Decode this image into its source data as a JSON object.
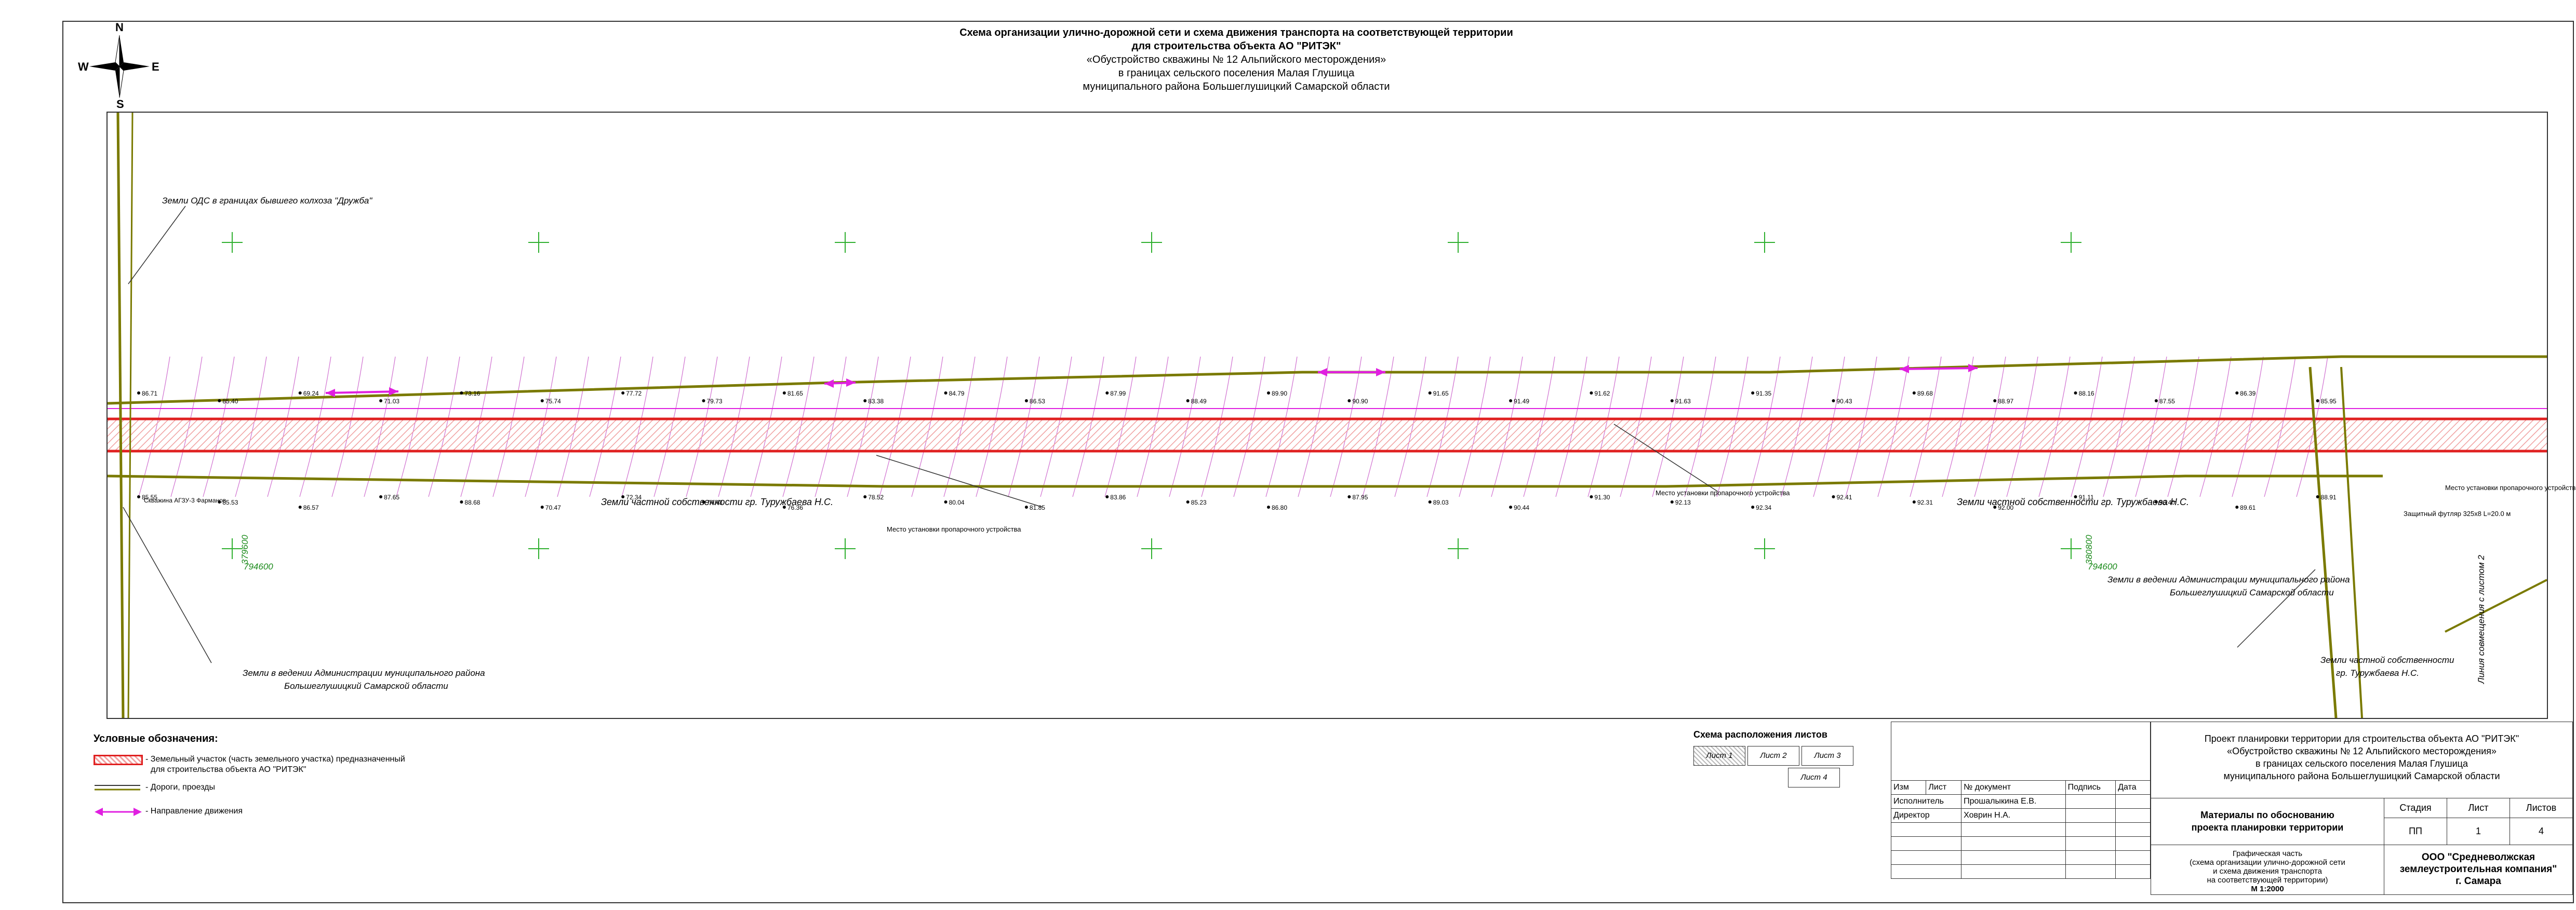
{
  "title": {
    "line1": "Схема организации улично-дорожной сети и схема движения транспорта на соответствующей территории",
    "line2": "для строительства объекта АО \"РИТЭК\"",
    "line3": "«Обустройство скважины № 12 Альпийского месторождения»",
    "line4": "в границах сельского поселения Малая Глушица",
    "line5": "муниципального района Большеглушицкий Самарской области"
  },
  "compass": {
    "n": "N",
    "s": "S",
    "w": "W",
    "e": "E"
  },
  "map_labels": {
    "ods_lands": "Земли ОДС в границах бывшего колхоза \"Дружба\"",
    "admin_lands_left_1": "Земли в ведении Администрации муниципального района",
    "admin_lands_left_2": "Большеглушицкий Самарской области",
    "private_lands_1": "Земли частной собственности гр. Туружбаева Н.С.",
    "private_lands_2": "Земли частной собственности гр. Туружбаева Н.С.",
    "admin_lands_right_1": "Земли в ведении Администрации муниципального района",
    "admin_lands_right_2": "Большеглушицкий Самарской области",
    "private_lands_right_1": "Земли частной собственности",
    "private_lands_right_2": "гр. Туружбаева Н.С.",
    "combine_line": "Линия совмещения с листом 2",
    "device_place_1": "Место установки пропарочного устройства",
    "device_place_2": "Место установки пропарочного устройства",
    "device_place_3": "Место установки пропарочного устройства",
    "protect_case": "Защитный футляр 325х8 L=20.0 м",
    "well_label": "Скважина АГЗУ-3 Фарманов"
  },
  "coord_labels": {
    "x1": "379600",
    "y1": "794600",
    "x2": "380800",
    "y2": "794600"
  },
  "elevations": [
    "85.55",
    "85.53",
    "86.57",
    "87.65",
    "88.68",
    "70.47",
    "72.34",
    "74.43",
    "76.36",
    "78.52",
    "80.04",
    "81.85",
    "83.86",
    "85.23",
    "86.80",
    "87.95",
    "89.03",
    "90.44",
    "91.30",
    "92.13",
    "92.34",
    "92.41",
    "92.31",
    "92.00",
    "91.11",
    "90.40",
    "89.61",
    "88.91",
    "86.71",
    "85.40",
    "69.24",
    "71.03",
    "73.16",
    "75.74",
    "77.72",
    "79.73",
    "81.65",
    "83.38",
    "84.79",
    "86.53",
    "87.99",
    "88.49",
    "89.90",
    "90.90",
    "91.65",
    "91.49",
    "91.62",
    "91.63",
    "91.35",
    "90.43",
    "89.68",
    "88.97",
    "88.16",
    "87.55",
    "86.39",
    "85.95"
  ],
  "legend": {
    "title": "Условные обозначения:",
    "item1_line1": "- Земельный участок (часть земельного участка) предназначенный",
    "item1_line2": "для строительства объекта АО \"РИТЭК\"",
    "item2": "- Дороги, проезды",
    "item3": "- Направление движения"
  },
  "sheet_scheme": {
    "title": "Схема расположения листов",
    "sheet1": "Лист 1",
    "sheet2": "Лист 2",
    "sheet3": "Лист 3",
    "sheet4": "Лист 4"
  },
  "stamp": {
    "col_izm": "Изм",
    "col_list": "Лист",
    "col_doc": "№ документ",
    "col_sign": "Подпись",
    "col_date": "Дата",
    "role1": "Исполнитель",
    "name1": "Прошалыкина Е.В.",
    "role2": "Директор",
    "name2": "Ховрин Н.А.",
    "project_line1": "Проект планировки территории для строительства объекта АО \"РИТЭК\"",
    "project_line2": "«Обустройство скважины № 12 Альпийского месторождения»",
    "project_line3": "в границах сельского поселения Малая Глушица",
    "project_line4": "муниципального района Большеглушицкий Самарской области",
    "materials_line1": "Материалы по обоснованию",
    "materials_line2": "проекта планировки территории",
    "stage_label": "Стадия",
    "sheet_label": "Лист",
    "sheets_label": "Листов",
    "stage_value": "ПП",
    "sheet_value": "1",
    "sheets_value": "4",
    "graphic_line1": "Графическая часть",
    "graphic_line2": "(схема организации улично-дорожной сети",
    "graphic_line3": "и схема движения транспорта",
    "graphic_line4": "на соответствующей территории)",
    "scale": "М 1:2000",
    "company_line1": "ООО \"Средневолжская",
    "company_line2": "землеустроительная компания\"",
    "company_line3": "г. Самара"
  },
  "colors": {
    "road": "#7a7a00",
    "parcel": "#e02020",
    "hatch": "#f2a0a0",
    "direction": "#e020e0",
    "grid": "#30b030",
    "contour": "#d070d0"
  }
}
